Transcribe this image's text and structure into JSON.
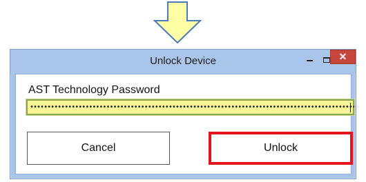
{
  "window": {
    "title": "Unlock Device",
    "minimize_glyph": "",
    "close_glyph": "✕"
  },
  "form": {
    "password_label": "AST Technology Password",
    "password_value": "••••••••••••••••••••••••••••••••••••••••••••••••••••••••••••••••••••••••••••••••••••••••••••••"
  },
  "buttons": {
    "cancel_label": "Cancel",
    "unlock_label": "Unlock"
  },
  "icons": {
    "pointer": "down-arrow-icon",
    "minimize": "minimize-icon",
    "maximize": "maximize-icon",
    "close": "close-icon"
  },
  "colors": {
    "arrow_fill": "#ffffa6",
    "arrow_stroke": "#4a7ab8",
    "highlight_border": "#e3141b",
    "field_fill": "#f7f598",
    "titlebar": "#aac5ea",
    "close_button": "#c7473d"
  }
}
